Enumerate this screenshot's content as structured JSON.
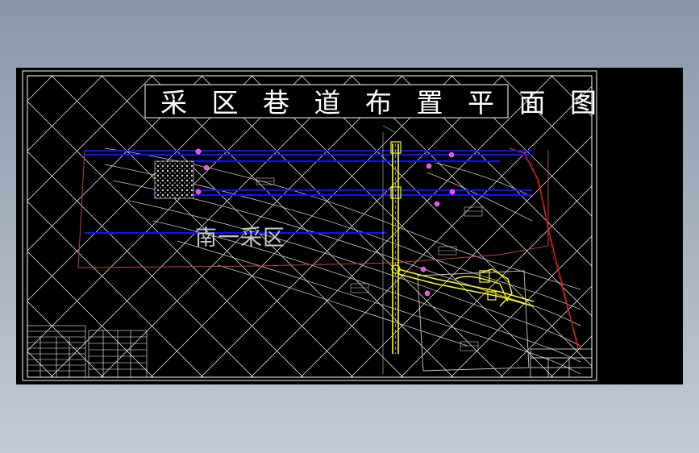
{
  "drawing": {
    "title": "采区巷道布置平面图",
    "region_label": "南一采区"
  },
  "colors": {
    "background": "#000000",
    "grid": "#ffffff",
    "roadway": "#0000ff",
    "shaft": "#ffff00",
    "boundary": "#ff2020",
    "contour": "#c8c8c8",
    "marker": "#ff40ff"
  }
}
